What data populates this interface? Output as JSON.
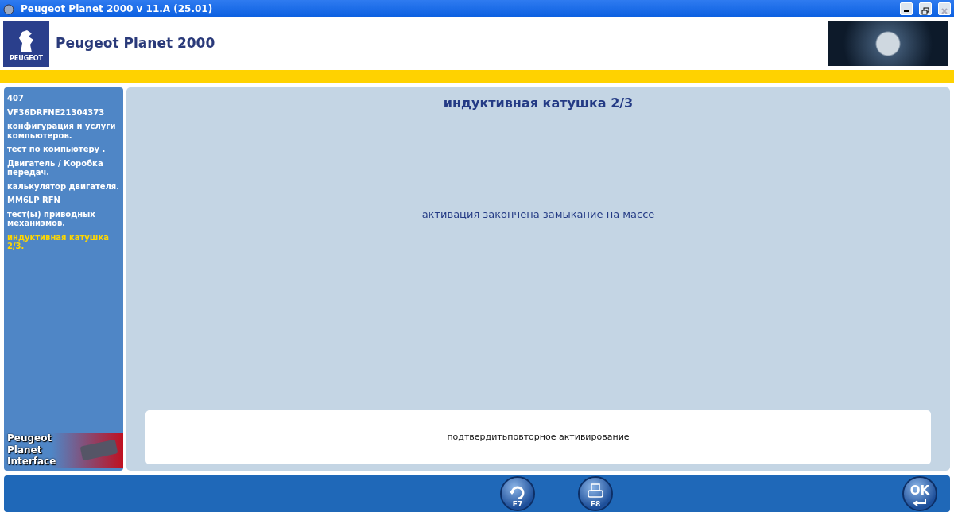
{
  "window": {
    "title": "Peugeot Planet 2000 v 11.A (25.01)"
  },
  "header": {
    "logo_text": "PEUGEOT",
    "title": "Peugeot Planet 2000"
  },
  "sidebar": {
    "items": [
      {
        "label": "407",
        "selected": false
      },
      {
        "label": "VF36DRFNE21304373",
        "selected": false
      },
      {
        "label": "конфигурация и услуги компьютеров.",
        "selected": false
      },
      {
        "label": "тест по компьютеру .",
        "selected": false
      },
      {
        "label": "Двигатель / Коробка передач.",
        "selected": false
      },
      {
        "label": "калькулятор двигателя.",
        "selected": false
      },
      {
        "label": "MM6LP RFN",
        "selected": false
      },
      {
        "label": "тест(ы) приводных механизмов.",
        "selected": false
      },
      {
        "label": "индуктивная катушка 2/3.",
        "selected": true
      }
    ],
    "interface_banner": [
      "Peugeot Planet",
      "Interface"
    ]
  },
  "content": {
    "title": "индуктивная катушка 2/3",
    "message": "активация закончена замыкание на массе",
    "prompt": "подтвердитьповторное активирование"
  },
  "footer": {
    "buttons": [
      {
        "kind": "repeat",
        "label": "F7"
      },
      {
        "kind": "print",
        "label": "F8"
      },
      {
        "kind": "ok",
        "label": "OK"
      }
    ]
  }
}
